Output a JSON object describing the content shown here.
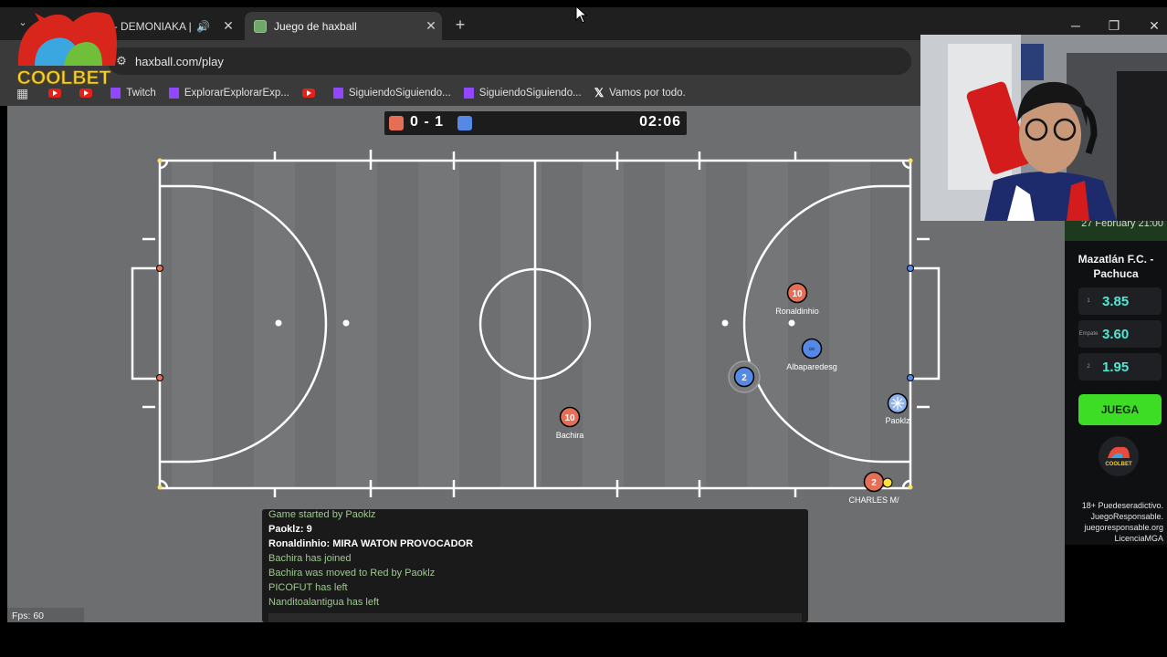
{
  "browser": {
    "tabs": [
      {
        "title": "! - DEMONIAKA |",
        "active": false
      },
      {
        "title": "Juego de haxball",
        "active": true
      }
    ],
    "url": "haxball.com/play",
    "bookmarks": [
      {
        "type": "youtube",
        "label": ""
      },
      {
        "type": "youtube",
        "label": ""
      },
      {
        "type": "twitch",
        "label": "Twitch"
      },
      {
        "type": "twitch",
        "label": "ExplorarExplorarExp..."
      },
      {
        "type": "youtube",
        "label": ""
      },
      {
        "type": "twitch",
        "label": "SiguiendoSiguiendo..."
      },
      {
        "type": "twitch",
        "label": "SiguiendoSiguiendo..."
      },
      {
        "type": "x",
        "label": "Vamos por todo."
      }
    ]
  },
  "scoreboard": {
    "score": "0 - 1",
    "time": "02:06"
  },
  "players": [
    {
      "team": "red",
      "number": "10",
      "name": "Ronaldinhio"
    },
    {
      "team": "blue",
      "number": "",
      "name": "Albaparedesg"
    },
    {
      "team": "blue",
      "number": "2",
      "name": ""
    },
    {
      "team": "red",
      "number": "10",
      "name": "Bachira"
    },
    {
      "team": "blue",
      "number": "",
      "name": "Paoklz"
    },
    {
      "team": "red",
      "number": "2",
      "name": "CHARLES M/"
    }
  ],
  "chat": [
    {
      "kind": "sys",
      "text": "Game started by Paoklz"
    },
    {
      "kind": "msg",
      "text": "Paoklz: 9"
    },
    {
      "kind": "msg",
      "text": "Ronaldinhio: MIRA WATON PROVOCADOR"
    },
    {
      "kind": "sys",
      "text": "Bachira has joined"
    },
    {
      "kind": "sys",
      "text": "Bachira was moved to Red by Paoklz"
    },
    {
      "kind": "sys",
      "text": "PICOFUT has left"
    },
    {
      "kind": "sys",
      "text": "Nanditoalantigua has left"
    }
  ],
  "fps": "Fps: 60",
  "ad": {
    "brand": "COOLBET",
    "date": "27 February 21:00",
    "match_line1": "Mazatlán F.C. -",
    "match_line2": "Pachuca",
    "odds": [
      {
        "tag": "1",
        "value": "3.85"
      },
      {
        "tag": "Empate",
        "value": "3.60"
      },
      {
        "tag": "2",
        "value": "1.95"
      }
    ],
    "cta": "JUEGA",
    "legal": [
      "18+ Puedeseradictivo.",
      "JuegoResponsable.",
      "juegoresponsable.org",
      "LicenciaMGA"
    ]
  },
  "colors": {
    "red_team": "#e56e56",
    "blue_team": "#5689e5",
    "accent_odds": "#52e7d3",
    "cta_green": "#3ddc25"
  }
}
